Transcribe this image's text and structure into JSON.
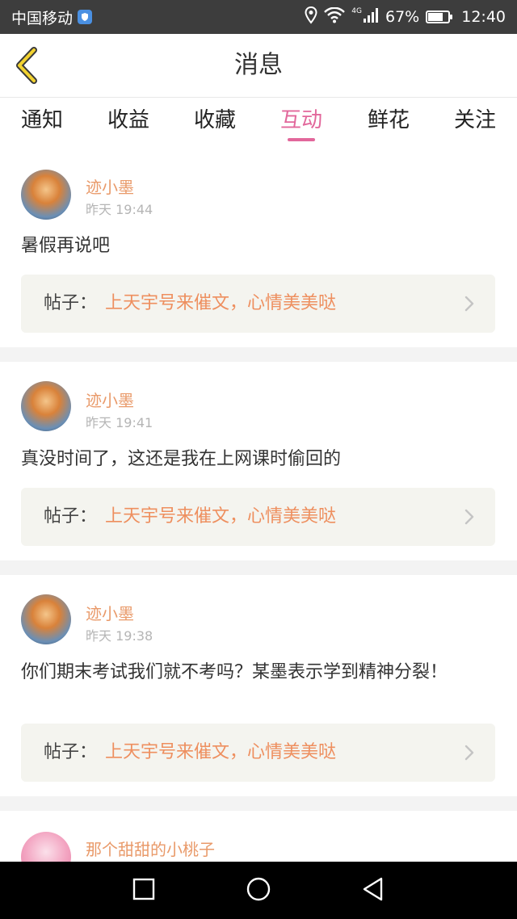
{
  "status_bar": {
    "carrier": "中国移动",
    "signal_label": "4G",
    "battery": "67%",
    "battery_level": 0.67,
    "time": "12:40"
  },
  "header": {
    "title": "消息"
  },
  "tabs": [
    {
      "label": "通知"
    },
    {
      "label": "收益"
    },
    {
      "label": "收藏"
    },
    {
      "label": "互动",
      "active": true
    },
    {
      "label": "鲜花"
    },
    {
      "label": "关注"
    }
  ],
  "post_label": "帖子：",
  "messages": [
    {
      "user": "迹小墨",
      "time": "昨天 19:44",
      "text": "暑假再说吧",
      "post_title": "上天宇号来催文，心情美美哒"
    },
    {
      "user": "迹小墨",
      "time": "昨天 19:41",
      "text": "真没时间了，这还是我在上网课时偷回的",
      "post_title": "上天宇号来催文，心情美美哒"
    },
    {
      "user": "迹小墨",
      "time": "昨天 19:38",
      "text": "你们期末考试我们就不考吗？某墨表示学到精神分裂！",
      "post_title": "上天宇号来催文，心情美美哒"
    },
    {
      "user": "那个甜甜的小桃子"
    }
  ],
  "colors": {
    "accent": "#e2679b",
    "username": "#e99a6a",
    "post_title": "#ee8f5f",
    "post_bg": "#f4f4ef",
    "status_bar": "#3d3d3d"
  },
  "icons": {
    "back": "chevron-left-icon",
    "post_arrow": "chevron-right-icon",
    "nav": [
      "square-icon",
      "circle-icon",
      "triangle-back-icon"
    ]
  }
}
